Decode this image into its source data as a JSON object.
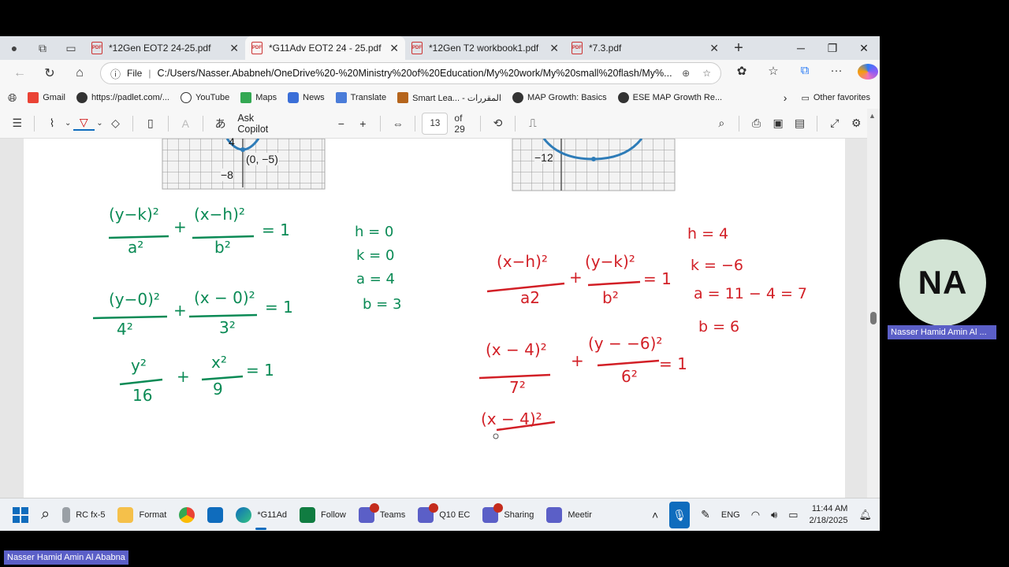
{
  "tabs": [
    {
      "title": "*12Gen EOT2 24-25.pdf",
      "close": "✕"
    },
    {
      "title": "*G11Adv EOT2 24 - 25.pdf",
      "close": "✕"
    },
    {
      "title": "*12Gen T2 workbook1.pdf",
      "close": "✕"
    },
    {
      "title": "*7.3.pdf",
      "close": "✕"
    }
  ],
  "address": {
    "scheme_label": "File",
    "url": "C:/Users/Nasser.Ababneh/OneDrive%20-%20Ministry%20of%20Education/My%20work/My%20small%20flash/My%..."
  },
  "favorites": [
    {
      "label": "Gmail",
      "icon": "gmail-icon"
    },
    {
      "label": "https://padlet.com/...",
      "icon": "padlet-icon"
    },
    {
      "label": "YouTube",
      "icon": "globe-icon"
    },
    {
      "label": "Maps",
      "icon": "maps-icon"
    },
    {
      "label": "News",
      "icon": "news-icon"
    },
    {
      "label": "Translate",
      "icon": "translate-icon"
    },
    {
      "label": "Smart Lea... - المقررات",
      "icon": "smart-learning-icon"
    },
    {
      "label": "MAP Growth: Basics",
      "icon": "map-growth-icon"
    },
    {
      "label": "ESE MAP Growth Re...",
      "icon": "map-growth-icon"
    }
  ],
  "other_favorites": "Other favorites",
  "pdf_toolbar": {
    "ask_copilot": "Ask Copilot",
    "page_current": "13",
    "page_total": "of 29"
  },
  "graph_labels": {
    "left_point": "(0, −5)",
    "left_tick_4": "4",
    "left_tick_neg8": "−8",
    "right_tick_neg12": "−12"
  },
  "ink_left": {
    "line1_num1": "(y−k)²",
    "line1_den1": "a²",
    "line1_plus": "+",
    "line1_num2": "(x−h)²",
    "line1_den2": "b²",
    "line1_eq": "= 1",
    "vars": [
      "h = 0",
      "k = 0",
      "a = 4",
      "b = 3"
    ],
    "line2_num1": "(y−0)²",
    "line2_den1": "4²",
    "line2_plus": "+",
    "line2_num2": "(x − 0)²",
    "line2_den2": "3²",
    "line2_eq": "= 1",
    "line3_num1": "y²",
    "line3_den1": "16",
    "line3_plus": "+",
    "line3_num2": "x²",
    "line3_den2": "9",
    "line3_eq": "= 1"
  },
  "ink_right": {
    "line1_num1": "(x−h)²",
    "line1_den1": "a2",
    "line1_plus": "+",
    "line1_num2": "(y−k)²",
    "line1_den2": "b²",
    "line1_eq": "= 1",
    "vars": [
      "h = 4",
      "k = −6",
      "a = 11 − 4 = 7",
      "b = 6"
    ],
    "line2_num1": "(x − 4)²",
    "line2_den1": "7²",
    "line2_plus": "+",
    "line2_num2": "(y − −6)²",
    "line2_den2": "6²",
    "line2_eq": "= 1",
    "line3_num1": "(x − 4)²"
  },
  "taskbar": [
    {
      "label": "RC fx-5",
      "icon": "calculator-icon"
    },
    {
      "label": "Format",
      "icon": "folder-icon"
    },
    {
      "label": "",
      "icon": "chrome-icon"
    },
    {
      "label": "",
      "icon": "outlook-icon"
    },
    {
      "label": "*G11Ad",
      "icon": "edge-icon"
    },
    {
      "label": "Follow",
      "icon": "excel-icon"
    },
    {
      "label": "Teams",
      "icon": "teams-icon"
    },
    {
      "label": "Q10 EC",
      "icon": "teams-icon"
    },
    {
      "label": "Sharing",
      "icon": "teams-icon"
    },
    {
      "label": "Meetir",
      "icon": "teams-icon"
    }
  ],
  "tray": {
    "lang": "ENG",
    "time": "11:44 AM",
    "date": "2/18/2025"
  },
  "participant": {
    "initials": "NA",
    "name": "Nasser Hamid Amin Al  ...",
    "name_bottom": "Nasser Hamid Amin Al  Ababna"
  },
  "colors": {
    "ink_green": "#0a8a55",
    "ink_red": "#d21f26",
    "graph_blue": "#2e7cb8",
    "teams_purple": "#5b5fc7"
  }
}
